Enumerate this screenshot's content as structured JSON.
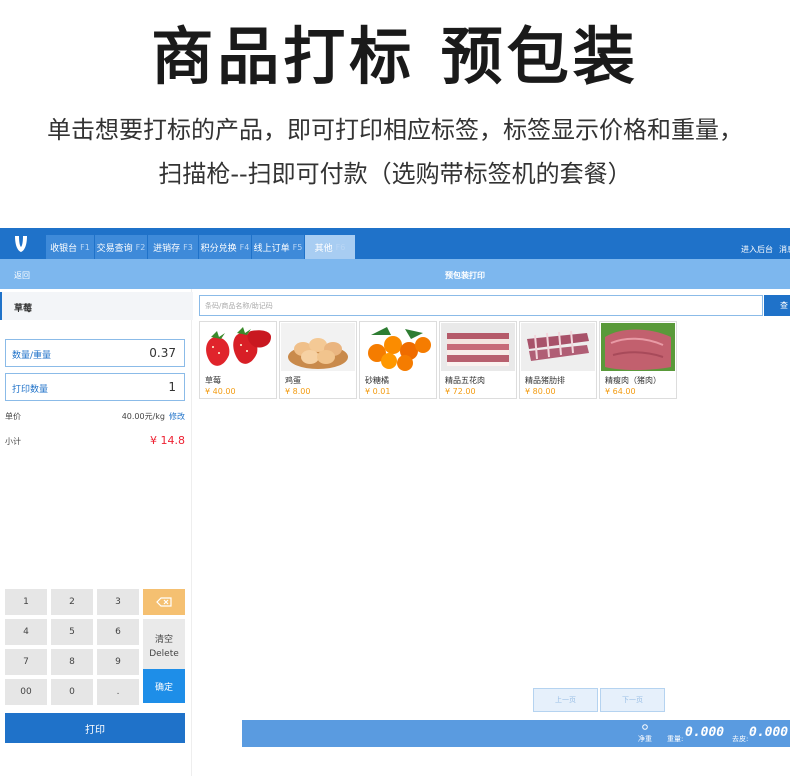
{
  "hero": {
    "title": "商品打标 预包装",
    "line1": "单击想要打标的产品，即可打印相应标签，标签显示价格和重量，",
    "line2": "扫描枪--扫即可付款（选购带标签机的套餐）"
  },
  "topbar": {
    "tabs": [
      {
        "label": "收银台",
        "key": "F1"
      },
      {
        "label": "交易查询",
        "key": "F2"
      },
      {
        "label": "进销存",
        "key": "F3"
      },
      {
        "label": "积分兑换",
        "key": "F4"
      },
      {
        "label": "线上订单",
        "key": "F5"
      },
      {
        "label": "其他",
        "key": "F6"
      }
    ],
    "enter_backend": "进入后台",
    "messages": "消息"
  },
  "subbar": {
    "back": "返回",
    "title": "预包装打印"
  },
  "left": {
    "product_name": "草莓",
    "qty_weight_label": "数量/重量",
    "qty_weight_value": "0.37",
    "print_count_label": "打印数量",
    "print_count_value": "1",
    "unit_price_label": "单价",
    "unit_price_value": "40.00元/kg",
    "edit_label": "修改",
    "subtotal_label": "小计",
    "subtotal_value": "¥ 14.8",
    "keys": [
      "1",
      "2",
      "3",
      "4",
      "5",
      "6",
      "7",
      "8",
      "9",
      "00",
      "0",
      "."
    ],
    "clear_label": "清空",
    "delete_label": "Delete",
    "confirm_label": "确定",
    "print_label": "打印"
  },
  "search": {
    "placeholder": "条码/商品名称/助记码",
    "button": "查"
  },
  "products": [
    {
      "name": "草莓",
      "price": "¥ 40.00",
      "icon": "strawberry-image"
    },
    {
      "name": "鸡蛋",
      "price": "¥ 8.00",
      "icon": "eggs-image"
    },
    {
      "name": "砂糖橘",
      "price": "¥ 0.01",
      "icon": "oranges-image"
    },
    {
      "name": "精品五花肉",
      "price": "¥ 72.00",
      "icon": "pork-belly-image"
    },
    {
      "name": "精品猪肋排",
      "price": "¥ 80.00",
      "icon": "pork-ribs-image"
    },
    {
      "name": "精瘦肉（猪肉）",
      "price": "¥ 64.00",
      "icon": "lean-pork-image"
    }
  ],
  "pager": {
    "prev": "上一页",
    "next": "下一页"
  },
  "scale": {
    "net_label": "净重",
    "weight_label": "重量:",
    "weight_value": "0.000",
    "tare_label": "去皮:",
    "tare_value": "0.000"
  },
  "colors": {
    "primary": "#1f72c9",
    "light": "#7db7ee",
    "price": "#f39c12",
    "subtotal": "#e23333"
  }
}
